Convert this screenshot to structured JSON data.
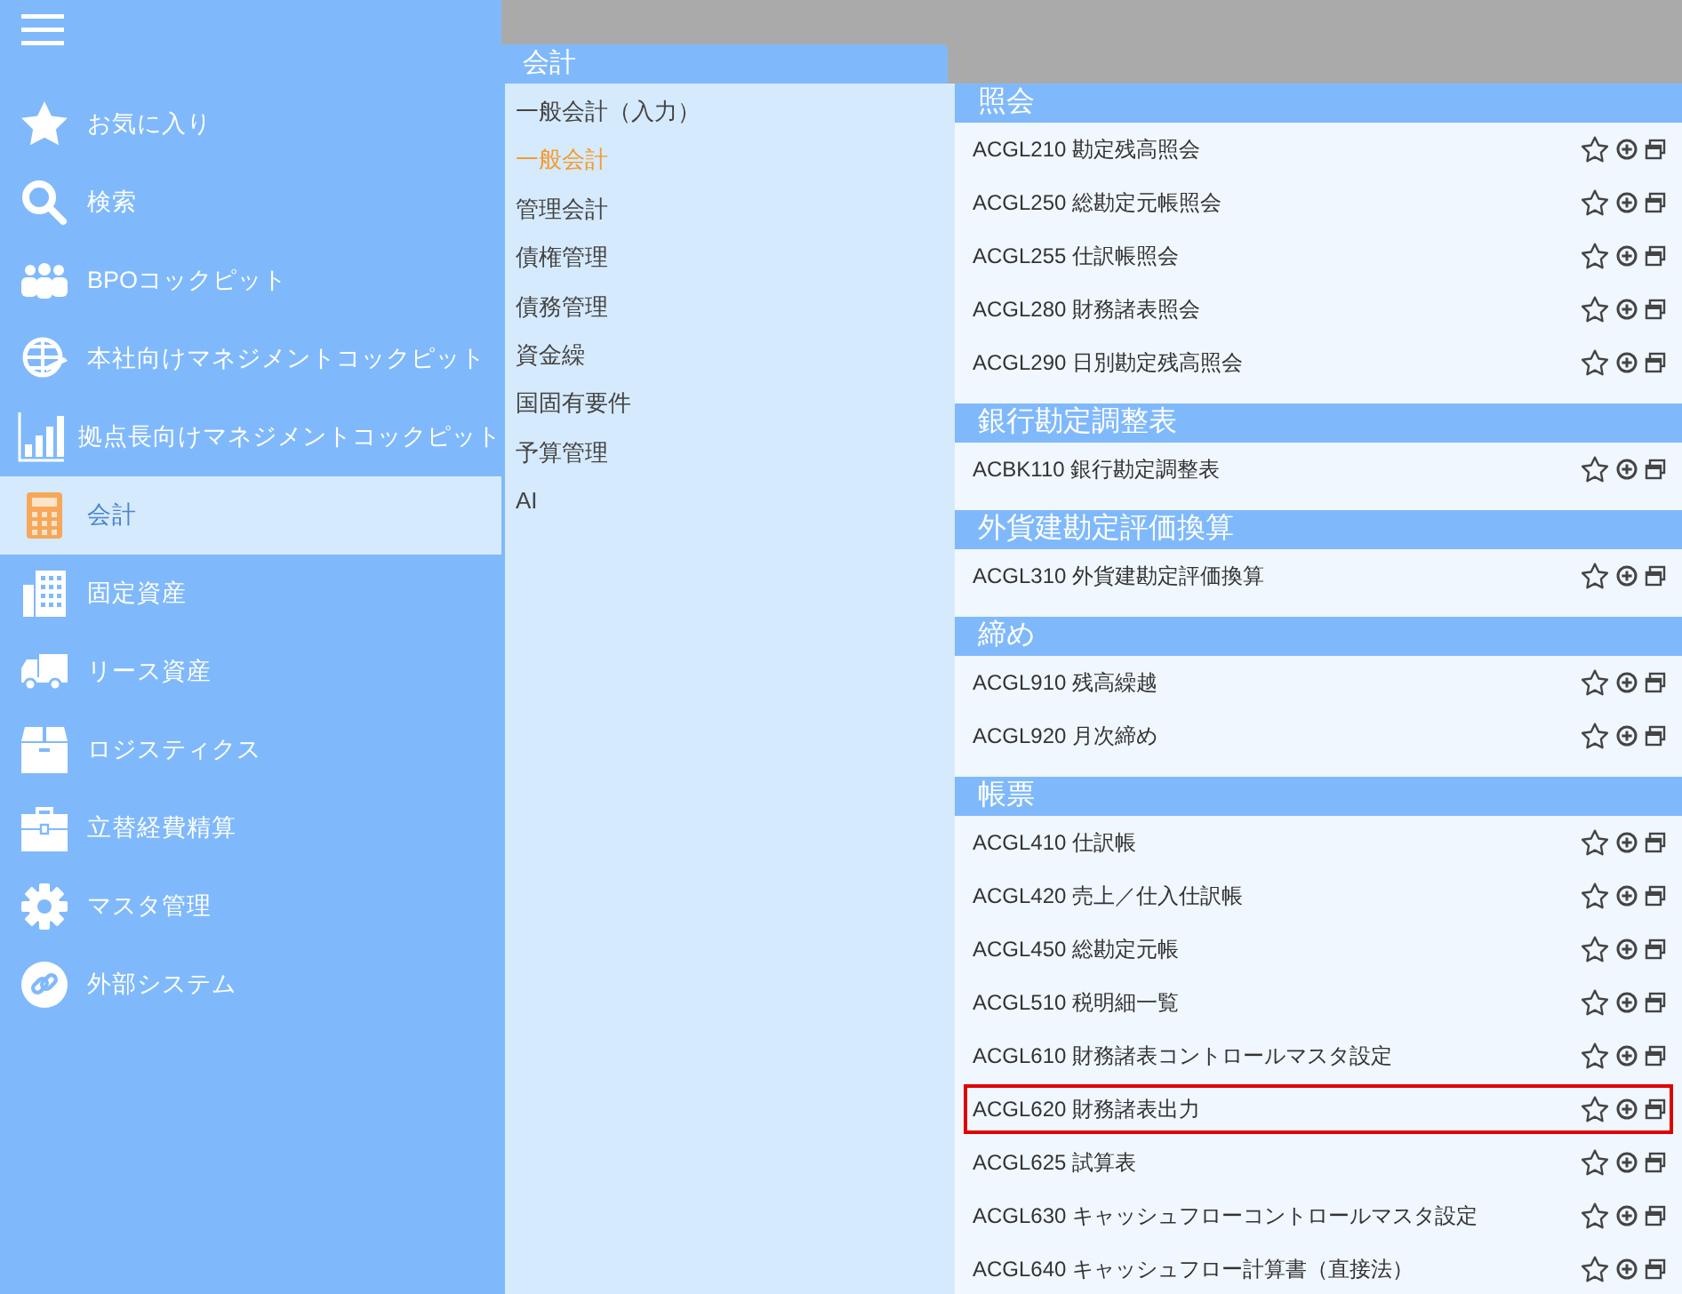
{
  "sidebar": {
    "items": [
      {
        "label": "お気に入り",
        "selected": false
      },
      {
        "label": "検索",
        "selected": false
      },
      {
        "label": "BPOコックピット",
        "selected": false
      },
      {
        "label": "本社向けマネジメントコックピット",
        "selected": false
      },
      {
        "label": "拠点長向けマネジメントコックピット",
        "selected": false
      },
      {
        "label": "会計",
        "selected": true
      },
      {
        "label": "固定資産",
        "selected": false
      },
      {
        "label": "リース資産",
        "selected": false
      },
      {
        "label": "ロジスティクス",
        "selected": false
      },
      {
        "label": "立替経費精算",
        "selected": false
      },
      {
        "label": "マスタ管理",
        "selected": false
      },
      {
        "label": "外部システム",
        "selected": false
      }
    ]
  },
  "submenu": {
    "title": "会計",
    "items": [
      {
        "label": "一般会計（入力）",
        "selected": false
      },
      {
        "label": "一般会計",
        "selected": true
      },
      {
        "label": "管理会計",
        "selected": false
      },
      {
        "label": "債権管理",
        "selected": false
      },
      {
        "label": "債務管理",
        "selected": false
      },
      {
        "label": "資金繰",
        "selected": false
      },
      {
        "label": "国固有要件",
        "selected": false
      },
      {
        "label": "予算管理",
        "selected": false
      },
      {
        "label": "AI",
        "selected": false
      }
    ]
  },
  "sections": [
    {
      "title": "照会",
      "rows": [
        {
          "label": "ACGL210 勘定残高照会",
          "highlighted": false
        },
        {
          "label": "ACGL250 総勘定元帳照会",
          "highlighted": false
        },
        {
          "label": "ACGL255 仕訳帳照会",
          "highlighted": false
        },
        {
          "label": "ACGL280 財務諸表照会",
          "highlighted": false
        },
        {
          "label": "ACGL290 日別勘定残高照会",
          "highlighted": false
        }
      ]
    },
    {
      "title": "銀行勘定調整表",
      "rows": [
        {
          "label": "ACBK110 銀行勘定調整表",
          "highlighted": false
        }
      ]
    },
    {
      "title": "外貨建勘定評価換算",
      "rows": [
        {
          "label": "ACGL310 外貨建勘定評価換算",
          "highlighted": false
        }
      ]
    },
    {
      "title": "締め",
      "rows": [
        {
          "label": "ACGL910 残高繰越",
          "highlighted": false
        },
        {
          "label": "ACGL920 月次締め",
          "highlighted": false
        }
      ]
    },
    {
      "title": "帳票",
      "rows": [
        {
          "label": "ACGL410 仕訳帳",
          "highlighted": false
        },
        {
          "label": "ACGL420 売上／仕入仕訳帳",
          "highlighted": false
        },
        {
          "label": "ACGL450 総勘定元帳",
          "highlighted": false
        },
        {
          "label": "ACGL510 税明細一覧",
          "highlighted": false
        },
        {
          "label": "ACGL610 財務諸表コントロールマスタ設定",
          "highlighted": false
        },
        {
          "label": "ACGL620 財務諸表出力",
          "highlighted": true
        },
        {
          "label": "ACGL625 試算表",
          "highlighted": false
        },
        {
          "label": "ACGL630 キャッシュフローコントロールマスタ設定",
          "highlighted": false
        },
        {
          "label": "ACGL640 キャッシュフロー計算書（直接法）",
          "highlighted": false
        }
      ]
    }
  ]
}
